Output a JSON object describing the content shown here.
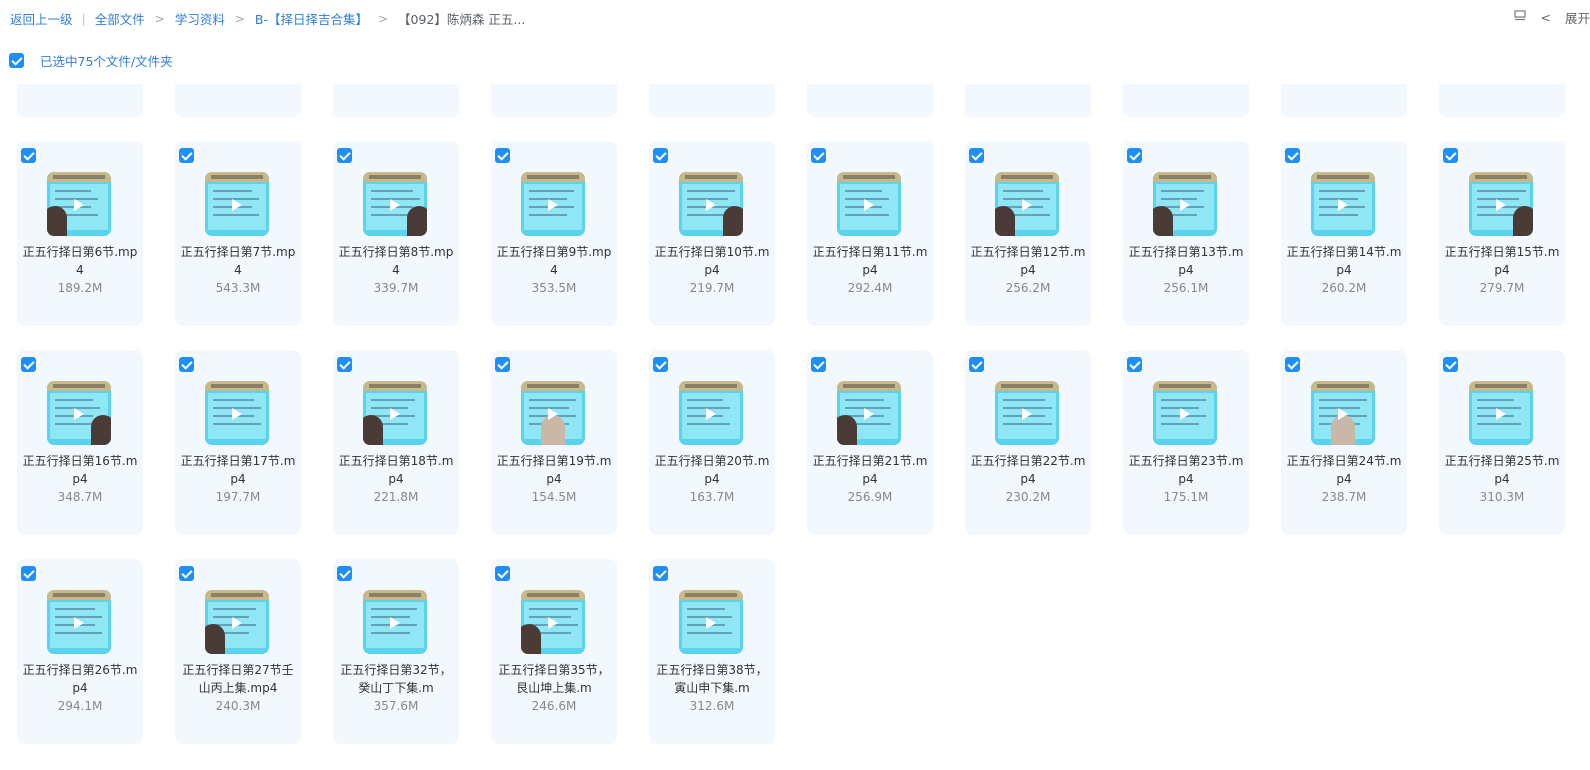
{
  "breadcrumb": {
    "back": "返回上一级",
    "all_files": "全部文件",
    "study": "学习资料",
    "folder_b": "B-【择日择吉合集】",
    "current": "【092】陈炳森 正五..."
  },
  "toolbar": {
    "expand_label": "展开"
  },
  "selection": {
    "label": "已选中75个文件/文件夹"
  },
  "files": [
    {
      "name": "正五行择日第6节.mp4",
      "size": "189.2M",
      "person": "left"
    },
    {
      "name": "正五行择日第7节.mp4",
      "size": "543.3M",
      "person": "none"
    },
    {
      "name": "正五行择日第8节.mp4",
      "size": "339.7M",
      "person": "right"
    },
    {
      "name": "正五行择日第9节.mp4",
      "size": "353.5M",
      "person": "none"
    },
    {
      "name": "正五行择日第10节.mp4",
      "size": "219.7M",
      "person": "right"
    },
    {
      "name": "正五行择日第11节.mp4",
      "size": "292.4M",
      "person": "none"
    },
    {
      "name": "正五行择日第12节.mp4",
      "size": "256.2M",
      "person": "left"
    },
    {
      "name": "正五行择日第13节.mp4",
      "size": "256.1M",
      "person": "left"
    },
    {
      "name": "正五行择日第14节.mp4",
      "size": "260.2M",
      "person": "none"
    },
    {
      "name": "正五行择日第15节.mp4",
      "size": "279.7M",
      "person": "right"
    },
    {
      "name": "正五行择日第16节.mp4",
      "size": "348.7M",
      "person": "right"
    },
    {
      "name": "正五行择日第17节.mp4",
      "size": "197.7M",
      "person": "none"
    },
    {
      "name": "正五行择日第18节.mp4",
      "size": "221.8M",
      "person": "left"
    },
    {
      "name": "正五行择日第19节.mp4",
      "size": "154.5M",
      "person": "center"
    },
    {
      "name": "正五行择日第20节.mp4",
      "size": "163.7M",
      "person": "none"
    },
    {
      "name": "正五行择日第21节.mp4",
      "size": "256.9M",
      "person": "left"
    },
    {
      "name": "正五行择日第22节.mp4",
      "size": "230.2M",
      "person": "none"
    },
    {
      "name": "正五行择日第23节.mp4",
      "size": "175.1M",
      "person": "none"
    },
    {
      "name": "正五行择日第24节.mp4",
      "size": "238.7M",
      "person": "center"
    },
    {
      "name": "正五行择日第25节.mp4",
      "size": "310.3M",
      "person": "none"
    },
    {
      "name": "正五行择日第26节.mp4",
      "size": "294.1M",
      "person": "none"
    },
    {
      "name": "正五行择日第27节壬山丙上集.mp4",
      "size": "240.3M",
      "person": "left"
    },
    {
      "name": "正五行择日第32节，癸山丁下集.m",
      "size": "357.6M",
      "person": "none"
    },
    {
      "name": "正五行择日第35节，艮山坤上集.m",
      "size": "246.6M",
      "person": "left"
    },
    {
      "name": "正五行择日第38节，寅山申下集.m",
      "size": "312.6M",
      "person": "none"
    }
  ],
  "colors": {
    "accent": "#1e90f5",
    "card_bg": "#f2f8fe",
    "link": "#2f7fd8"
  }
}
